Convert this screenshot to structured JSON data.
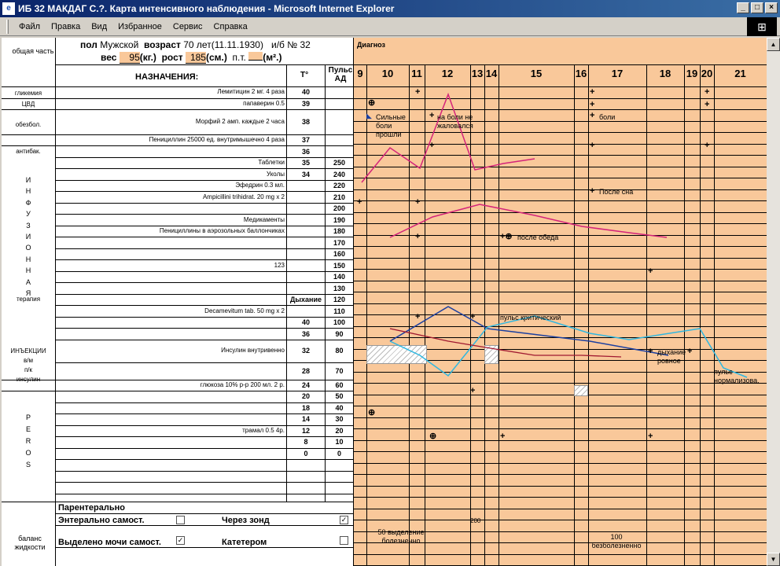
{
  "window": {
    "title": "ИБ 32 МАКДАГ С.?. Карта интенсивного наблюдения - Microsoft Internet Explorer",
    "minimize": "_",
    "maximize": "□",
    "close": "×"
  },
  "menu": {
    "items": [
      "Файл",
      "Правка",
      "Вид",
      "Избранное",
      "Сервис",
      "Справка"
    ]
  },
  "header": {
    "section_general": "общая часть",
    "sex_label": "пол",
    "sex_value": "Мужской",
    "age_label": "возраст",
    "age_value": "70 лет(11.11.1930)",
    "case_label": "и/б №",
    "case_value": "32",
    "weight_label": "вес",
    "weight_value": "95",
    "weight_unit": "(кг.)",
    "height_label": "рост",
    "height_value": "185",
    "height_unit": "(см.)",
    "bsa_label": "п.т.",
    "bsa_value": "",
    "bsa_unit": "(м².)",
    "diagnosis_label": "Диагноз",
    "prescriptions_label": "НАЗНАЧЕНИЯ:",
    "temp_label": "T°",
    "pulse_label": "Пульс АД"
  },
  "hours": [
    "9",
    "10",
    "11",
    "12",
    "13",
    "14",
    "15",
    "16",
    "17",
    "18",
    "19",
    "20",
    "21"
  ],
  "rows": [
    {
      "group": "гликемия",
      "drug": "Лемитицин 2 мг. 4 раза",
      "t": "40",
      "p": ""
    },
    {
      "group": "ЦВД",
      "drug": "папаверин 0.5",
      "t": "39",
      "p": ""
    },
    {
      "group": "обезбол.",
      "drug": "Морфий 2 амп. каждые 2 часа",
      "t": "38",
      "p": ""
    },
    {
      "group": "антибак.",
      "drug": "Пенициллин 25000 ед. внутримышечно 4 раза",
      "t": "37",
      "p": ""
    },
    {
      "group": "",
      "drug": "",
      "t": "36",
      "p": ""
    },
    {
      "group": "",
      "drug": "Таблетки",
      "t": "35",
      "p": "250"
    },
    {
      "group": "",
      "drug": "Уколы",
      "t": "34",
      "p": "240"
    },
    {
      "group": "",
      "drug": "Эфедрин 0.3 мл.",
      "t": "",
      "p": "220"
    },
    {
      "group": "",
      "drug": "Ampicillini trihidrat. 20 mg x 2",
      "t": "",
      "p": "210"
    },
    {
      "group": "",
      "drug": "",
      "t": "",
      "p": "200"
    },
    {
      "group": "",
      "drug": "Медикаменты",
      "t": "",
      "p": "190"
    },
    {
      "group": "",
      "drug": "Пенициллины в аэрозольных баллончиках",
      "t": "",
      "p": "180"
    },
    {
      "group": "",
      "drug": "",
      "t": "",
      "p": "170"
    },
    {
      "group": "",
      "drug": "",
      "t": "",
      "p": "160"
    },
    {
      "group": "",
      "drug": "123",
      "t": "",
      "p": "150"
    },
    {
      "group": "",
      "drug": "",
      "t": "",
      "p": "140"
    },
    {
      "group": "",
      "drug": "",
      "t": "",
      "p": "130"
    },
    {
      "group": "",
      "drug": "",
      "t": "Дыхание",
      "p": "120"
    },
    {
      "group": "",
      "drug": "Decamevitum tab. 50 mg x 2",
      "t": "",
      "p": "110"
    },
    {
      "group": "",
      "drug": "",
      "t": "40",
      "p": "100"
    },
    {
      "group": "",
      "drug": "",
      "t": "36",
      "p": "90"
    },
    {
      "group": "",
      "drug": "Инсулин внутривенно",
      "t": "32",
      "p": "80"
    },
    {
      "group": "",
      "drug": "",
      "t": "28",
      "p": "70"
    },
    {
      "group": "",
      "drug": "глюкоза 10% р-р 200 мл. 2 р.",
      "t": "24",
      "p": "60"
    },
    {
      "group": "",
      "drug": "",
      "t": "20",
      "p": "50"
    },
    {
      "group": "",
      "drug": "",
      "t": "18",
      "p": "40"
    },
    {
      "group": "",
      "drug": "",
      "t": "14",
      "p": "30"
    },
    {
      "group": "",
      "drug": "трамал 0.5 4р.",
      "t": "12",
      "p": "20"
    },
    {
      "group": "",
      "drug": "",
      "t": "8",
      "p": "10"
    },
    {
      "group": "",
      "drug": "",
      "t": "0",
      "p": "0"
    }
  ],
  "groups": {
    "infusion_letters": [
      "И",
      "Н",
      "Ф",
      "У",
      "З",
      "И",
      "О",
      "Н",
      "Н",
      "А",
      "Я"
    ],
    "infusion_word": "терапия",
    "injection": [
      "ИНЪЕКЦИИ",
      "в/м",
      "п/к",
      "инсулин"
    ],
    "per_os": [
      "P",
      "E",
      "R",
      "O",
      "S"
    ],
    "balance": "баланс жидкости"
  },
  "notes": {
    "pain_gone": "Сильные боли прошли",
    "no_complaint": "на боли не жаловался",
    "pain": "боли",
    "after_sleep": "После сна",
    "after_lunch": "после обеда",
    "critical_pulse": "пульс критический",
    "breathing_even": "дыхание ровное",
    "pulse_normal": "пульс нормализова.",
    "n200": "200",
    "output_50": "50 выделение болезненно",
    "output_100": "100 безболезненно"
  },
  "marks": {
    "plus": "+",
    "circle_plus": "⊕",
    "plus_circle": "+⊕"
  },
  "balance": {
    "parenteral": "Парентерально",
    "enteral": "Энтерально самост.",
    "enteral_checked": false,
    "tube": "Через зонд",
    "tube_checked": true,
    "urine": "Выделено мочи самост.",
    "urine_checked": true,
    "catheter": "Катетером",
    "catheter_checked": false
  },
  "series_colors": {
    "temp": "#d4247a",
    "pulse_ad": "#d4247a",
    "blue": "#1b3fa0",
    "cyan": "#2fb7e0",
    "red": "#a01830"
  }
}
